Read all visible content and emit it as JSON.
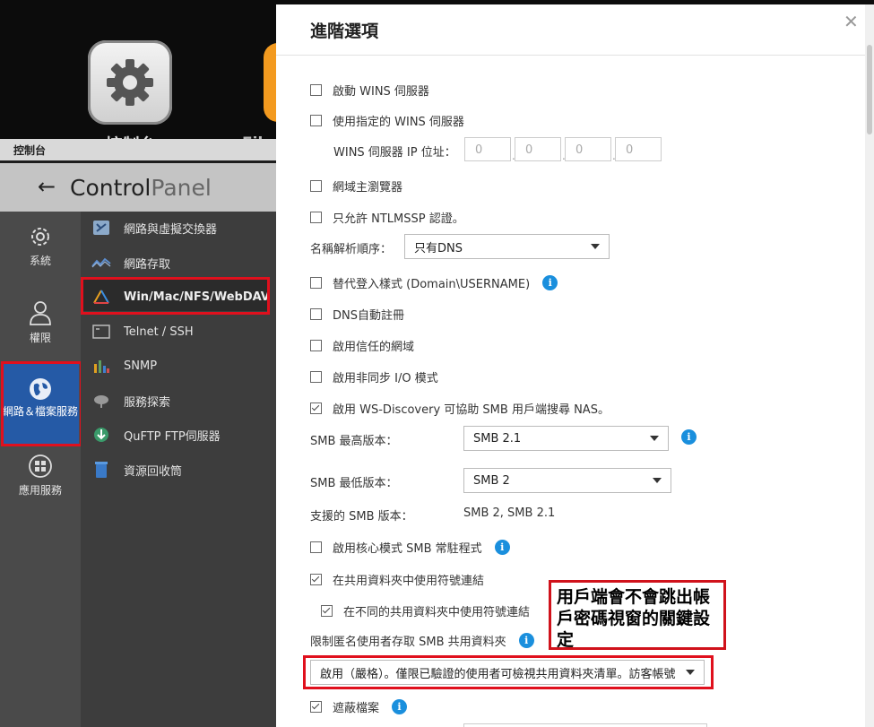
{
  "desktop": {
    "apps": [
      {
        "label": "控制台",
        "icon": "gear-icon"
      },
      {
        "label": "File",
        "icon": "file-station-icon"
      }
    ]
  },
  "control_panel": {
    "topbar_title": "控制台",
    "back_icon": "back-arrow-icon",
    "title_strong": "Control",
    "title_light": "Panel",
    "left_nav": [
      {
        "label": "系統",
        "icon": "gear-icon"
      },
      {
        "label": "權限",
        "icon": "user-icon"
      },
      {
        "label": "網路＆檔案服務",
        "icon": "globe-icon",
        "selected": true
      },
      {
        "label": "應用服務",
        "icon": "apps-grid-icon"
      }
    ],
    "sub_nav": [
      {
        "label": "網路與虛擬交換器",
        "icon": "network-switch-icon"
      },
      {
        "label": "網路存取",
        "icon": "network-access-icon"
      },
      {
        "label": "Win/Mac/NFS/WebDAV",
        "icon": "win-mac-nfs-icon",
        "selected": true
      },
      {
        "label": "Telnet / SSH",
        "icon": "terminal-icon"
      },
      {
        "label": "SNMP",
        "icon": "snmp-icon"
      },
      {
        "label": "服務探索",
        "icon": "service-discovery-icon"
      },
      {
        "label": "QuFTP FTP伺服器",
        "icon": "ftp-icon"
      },
      {
        "label": "資源回收筒",
        "icon": "recycle-bin-icon"
      }
    ]
  },
  "dialog": {
    "title": "進階選項",
    "close_icon": "close-icon",
    "options": {
      "wins_server": {
        "label": "啟動 WINS 伺服器",
        "checked": false
      },
      "specific_wins": {
        "label": "使用指定的 WINS 伺服器",
        "checked": false
      },
      "wins_ip_label": "WINS 伺服器 IP 位址：",
      "wins_ip": [
        "0",
        "0",
        "0",
        "0"
      ],
      "domain_master": {
        "label": "網域主瀏覽器",
        "checked": false
      },
      "ntlmssp": {
        "label": "只允許 NTLMSSP 認證。",
        "checked": false
      },
      "name_resolution_label": "名稱解析順序：",
      "name_resolution_value": "只有DNS",
      "alt_login": {
        "label": "替代登入樣式 (Domain\\USERNAME)",
        "checked": false
      },
      "dns_register": {
        "label": "DNS自動註冊",
        "checked": false
      },
      "trusted_domain": {
        "label": "啟用信任的網域",
        "checked": false
      },
      "async_io": {
        "label": "啟用非同步 I/O 模式",
        "checked": false
      },
      "ws_discovery": {
        "label": "啟用 WS-Discovery 可協助 SMB 用戶端搜尋 NAS。",
        "checked": true
      },
      "smb_max_label": "SMB 最高版本：",
      "smb_max_value": "SMB 2.1",
      "smb_min_label": "SMB 最低版本：",
      "smb_min_value": "SMB 2",
      "smb_supported_label": "支援的 SMB 版本：",
      "smb_supported_value": "SMB 2, SMB 2.1",
      "kernel_mode": {
        "label": "啟用核心模式 SMB 常駐程式",
        "checked": false
      },
      "symlinks": {
        "label": "在共用資料夾中使用符號連結",
        "checked": true
      },
      "wide_links": {
        "label": "在不同的共用資料夾中使用符號連結",
        "checked": true
      },
      "anon_restrict_label": "限制匿名使用者存取 SMB 共用資料夾",
      "anon_restrict_value": "啟用（嚴格）。僅限已驗證的使用者可檢視共用資料夾清單。訪客帳號",
      "veto_files": {
        "label": "遮蔽檔案",
        "checked": true
      }
    }
  },
  "annotation": {
    "callout_text": "用戶端會不會跳出帳戶密碼視窗的關鍵設定"
  },
  "colors": {
    "highlight_red": "#e0101d",
    "info_blue": "#1a8fdd",
    "nav_selected": "#255aa6"
  }
}
